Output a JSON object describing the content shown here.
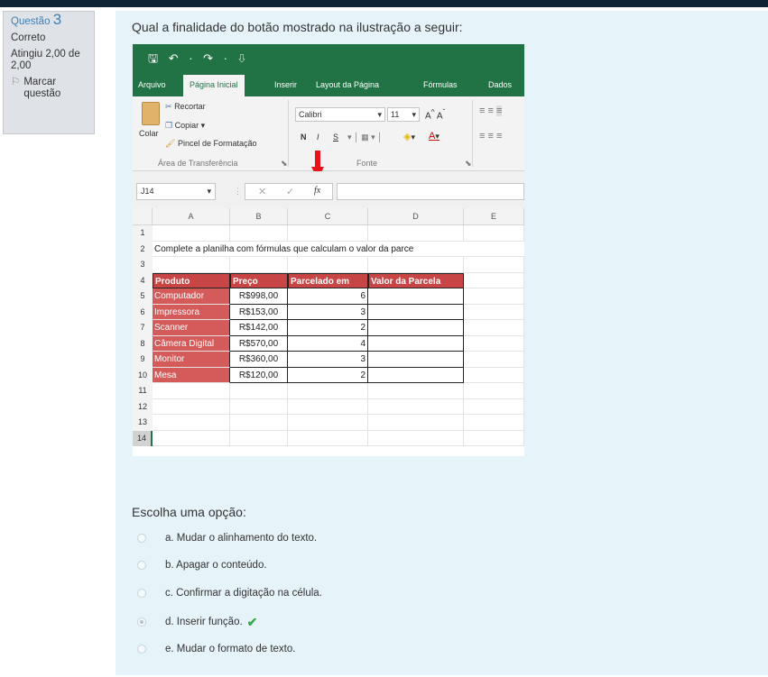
{
  "sidebar": {
    "question_label": "Questão",
    "question_number": "3",
    "status": "Correto",
    "grade": "Atingiu 2,00 de 2,00",
    "flag_label": "Marcar questão"
  },
  "question": {
    "text": "Qual a finalidade do botão mostrado na ilustração a seguir:"
  },
  "excel": {
    "qat": "🖫 ↶ · ↷ · ⇩",
    "tabs": [
      "Arquivo",
      "Página Inicial",
      "Inserir",
      "Layout da Página",
      "Fórmulas",
      "Dados"
    ],
    "ribbon": {
      "paste": "Colar",
      "cut": "Recortar",
      "copy": "Copiar",
      "format_painter": "Pincel de Formatação",
      "clipboard_group": "Área de Transferência",
      "font_name": "Calibri",
      "font_size": "11",
      "font_group": "Fonte",
      "bold": "N",
      "italic": "I",
      "underline": "S"
    },
    "name_box": "J14",
    "fx_label": "fx",
    "columns": [
      "A",
      "B",
      "C",
      "D",
      "E"
    ],
    "rows": [
      "1",
      "2",
      "3",
      "4",
      "5",
      "6",
      "7",
      "8",
      "9",
      "10",
      "11",
      "12",
      "13",
      "14"
    ],
    "instruction": "Complete a planilha com fórmulas que calculam o valor da parce",
    "headers": [
      "Produto",
      "Preço",
      "Parcelado em",
      "Valor da Parcela"
    ],
    "data": [
      [
        "Computador",
        "R$998,00",
        "6"
      ],
      [
        "Impressora",
        "R$153,00",
        "3"
      ],
      [
        "Scanner",
        "R$142,00",
        "2"
      ],
      [
        "Câmera Digital",
        "R$570,00",
        "4"
      ],
      [
        "Monitor",
        "R$360,00",
        "3"
      ],
      [
        "Mesa",
        "R$120,00",
        "2"
      ]
    ]
  },
  "options": {
    "prompt": "Escolha uma opção:",
    "items": [
      {
        "text": "a. Mudar o alinhamento do texto.",
        "selected": false
      },
      {
        "text": "b. Apagar o conteúdo.",
        "selected": false
      },
      {
        "text": "c. Confirmar a digitação na célula.",
        "selected": false
      },
      {
        "text": "d. Inserir função.",
        "selected": true,
        "correct": true
      },
      {
        "text": "e. Mudar o formato de texto.",
        "selected": false
      }
    ],
    "correct_mark": "✔"
  },
  "colors": {
    "excel_green": "#217346",
    "header_red": "#c84545",
    "cell_red": "#d55a5a",
    "content_bg": "#e6f3f9",
    "check_green": "#39a94f",
    "arrow_red": "#e8131b"
  }
}
